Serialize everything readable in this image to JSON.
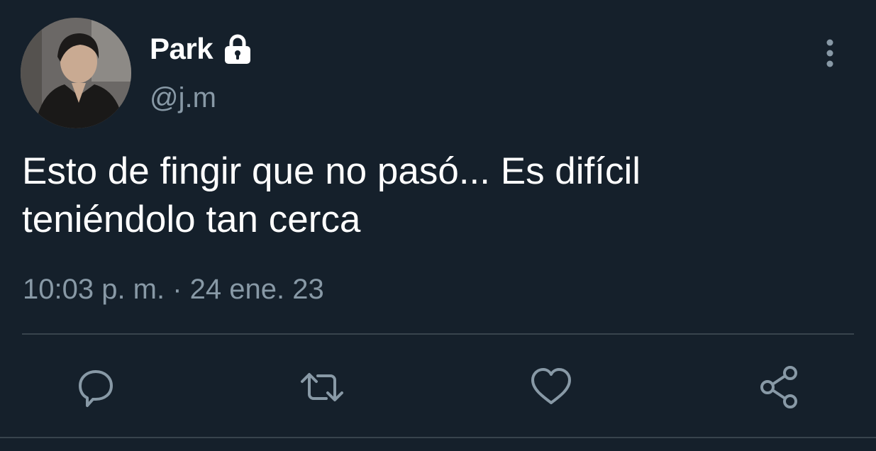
{
  "user": {
    "display_name": "Park",
    "handle": "@j.m",
    "protected": true
  },
  "tweet": {
    "text_line1": "Esto de fingir que no pasó... Es difícil",
    "text_line2": "teniéndolo tan cerca",
    "timestamp": "10:03 p. m. · 24 ene. 23"
  },
  "icons": {
    "lock": "lock-icon",
    "more": "more-vertical-icon",
    "reply": "reply-icon",
    "retweet": "retweet-icon",
    "like": "heart-icon",
    "share": "share-icon"
  },
  "colors": {
    "background": "#15202b",
    "text_primary": "#ffffff",
    "text_secondary": "#8899a6",
    "divider": "#38444d"
  }
}
